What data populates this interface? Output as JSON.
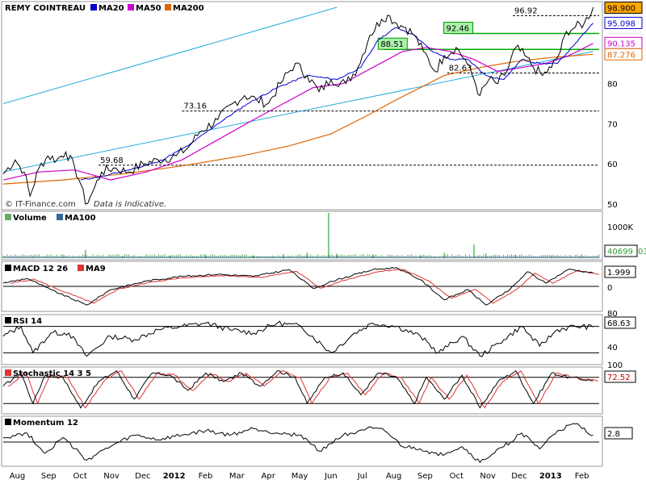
{
  "chart_data": {
    "type": "line",
    "title": "REMY COINTREAU",
    "copyright": "© IT-Finance.com",
    "disclaimer": "Data is Indicative.",
    "x_labels": [
      "Aug",
      "Sep",
      "Oct",
      "Nov",
      "Dec",
      "2012",
      "Feb",
      "Mar",
      "Apr",
      "May",
      "Jun",
      "Jul",
      "Aug",
      "Sep",
      "Oct",
      "Nov",
      "Dec",
      "2013",
      "Feb"
    ],
    "price_panel": {
      "ylim": [
        49,
        100
      ],
      "y_ticks": [
        50,
        60,
        70,
        80
      ],
      "legend": [
        {
          "name": "REMY COINTREAU",
          "color": "#000000"
        },
        {
          "name": "MA20",
          "color": "#0000cc"
        },
        {
          "name": "MA50",
          "color": "#cc00cc"
        },
        {
          "name": "MA200",
          "color": "#dd6600"
        }
      ],
      "badges": [
        {
          "label": "98.900",
          "color": "#ffa500",
          "value": 98.9
        },
        {
          "label": "95.098",
          "color": "#0000cc",
          "value": 95.1
        },
        {
          "label": "90.135",
          "color": "#cc00cc",
          "value": 90.1
        },
        {
          "label": "87.276",
          "color": "#dd6600",
          "value": 87.3
        }
      ],
      "level_labels": [
        {
          "label": "96.92",
          "value": 96.92,
          "from": 0.855
        },
        {
          "label": "92.46",
          "value": 92.46,
          "from": 0.75
        },
        {
          "label": "88.51",
          "value": 88.51,
          "from": 0.64
        },
        {
          "label": "82.63",
          "value": 82.63,
          "from": 0.745
        },
        {
          "label": "73.16",
          "value": 73.16,
          "from": 0.3
        },
        {
          "label": "59.68",
          "value": 59.68,
          "from": 0.16
        }
      ],
      "price_path": [
        [
          0,
          57.5
        ],
        [
          0.02,
          61
        ],
        [
          0.035,
          58
        ],
        [
          0.045,
          52
        ],
        [
          0.06,
          59
        ],
        [
          0.075,
          62
        ],
        [
          0.09,
          61
        ],
        [
          0.105,
          63
        ],
        [
          0.12,
          59
        ],
        [
          0.13,
          55
        ],
        [
          0.138,
          50
        ],
        [
          0.15,
          53
        ],
        [
          0.165,
          58
        ],
        [
          0.185,
          59
        ],
        [
          0.21,
          58
        ],
        [
          0.235,
          60
        ],
        [
          0.26,
          61
        ],
        [
          0.29,
          62
        ],
        [
          0.31,
          64
        ],
        [
          0.33,
          68
        ],
        [
          0.36,
          71
        ],
        [
          0.385,
          75
        ],
        [
          0.405,
          77
        ],
        [
          0.425,
          76
        ],
        [
          0.445,
          75
        ],
        [
          0.465,
          80
        ],
        [
          0.49,
          85
        ],
        [
          0.51,
          82
        ],
        [
          0.53,
          78
        ],
        [
          0.55,
          81
        ],
        [
          0.575,
          80
        ],
        [
          0.595,
          84
        ],
        [
          0.615,
          92
        ],
        [
          0.635,
          96
        ],
        [
          0.645,
          97
        ],
        [
          0.66,
          95
        ],
        [
          0.675,
          94
        ],
        [
          0.69,
          92
        ],
        [
          0.705,
          88
        ],
        [
          0.725,
          83
        ],
        [
          0.74,
          87
        ],
        [
          0.76,
          89
        ],
        [
          0.775,
          86
        ],
        [
          0.79,
          81
        ],
        [
          0.8,
          77
        ],
        [
          0.815,
          81
        ],
        [
          0.83,
          80
        ],
        [
          0.845,
          83
        ],
        [
          0.86,
          89
        ],
        [
          0.875,
          87
        ],
        [
          0.89,
          84
        ],
        [
          0.905,
          82
        ],
        [
          0.92,
          84
        ],
        [
          0.935,
          88
        ],
        [
          0.945,
          93
        ],
        [
          0.96,
          94
        ],
        [
          0.975,
          95
        ],
        [
          0.99,
          99
        ]
      ],
      "ma20_path": [
        [
          0.13,
          56
        ],
        [
          0.17,
          57
        ],
        [
          0.21,
          58.5
        ],
        [
          0.26,
          60.5
        ],
        [
          0.31,
          64.5
        ],
        [
          0.36,
          70
        ],
        [
          0.41,
          75
        ],
        [
          0.46,
          79
        ],
        [
          0.51,
          82
        ],
        [
          0.56,
          81
        ],
        [
          0.6,
          84
        ],
        [
          0.63,
          91
        ],
        [
          0.66,
          94
        ],
        [
          0.69,
          92
        ],
        [
          0.72,
          88
        ],
        [
          0.75,
          86
        ],
        [
          0.78,
          86
        ],
        [
          0.81,
          82
        ],
        [
          0.84,
          81
        ],
        [
          0.87,
          86
        ],
        [
          0.9,
          85
        ],
        [
          0.93,
          85
        ],
        [
          0.96,
          90
        ],
        [
          0.99,
          95
        ]
      ],
      "ma50_path": [
        [
          0.0,
          56
        ],
        [
          0.06,
          58
        ],
        [
          0.12,
          58.5
        ],
        [
          0.18,
          56
        ],
        [
          0.24,
          58
        ],
        [
          0.3,
          61
        ],
        [
          0.36,
          66
        ],
        [
          0.42,
          71
        ],
        [
          0.47,
          75
        ],
        [
          0.52,
          79
        ],
        [
          0.57,
          80
        ],
        [
          0.62,
          84
        ],
        [
          0.67,
          88
        ],
        [
          0.71,
          89
        ],
        [
          0.75,
          88
        ],
        [
          0.79,
          86
        ],
        [
          0.83,
          83
        ],
        [
          0.87,
          84
        ],
        [
          0.91,
          85
        ],
        [
          0.95,
          87
        ],
        [
          0.99,
          90
        ]
      ],
      "ma200_path": [
        [
          0.0,
          55
        ],
        [
          0.1,
          56
        ],
        [
          0.2,
          57.5
        ],
        [
          0.3,
          59.5
        ],
        [
          0.4,
          62
        ],
        [
          0.48,
          64.5
        ],
        [
          0.55,
          67.5
        ],
        [
          0.61,
          72
        ],
        [
          0.66,
          76
        ],
        [
          0.7,
          79
        ],
        [
          0.74,
          82
        ],
        [
          0.8,
          84
        ],
        [
          0.86,
          85.5
        ],
        [
          0.92,
          86.5
        ],
        [
          0.99,
          87.3
        ]
      ],
      "trendline_upper": [
        [
          0.0,
          75
        ],
        [
          0.56,
          99
        ]
      ],
      "trendline_lower": [
        [
          0.0,
          58
        ],
        [
          0.99,
          88
        ]
      ]
    },
    "volume_panel": {
      "legend": [
        {
          "name": "Volume",
          "color": "#66aa66"
        },
        {
          "name": "MA100",
          "color": "#336699"
        }
      ],
      "y_ticks_label": "1000K",
      "badge": "40699",
      "badge_suffix": "03",
      "spikes": [
        [
          0.0,
          0.05
        ],
        [
          0.05,
          0.06
        ],
        [
          0.1,
          0.08
        ],
        [
          0.138,
          0.18
        ],
        [
          0.2,
          0.05
        ],
        [
          0.28,
          0.06
        ],
        [
          0.34,
          0.07
        ],
        [
          0.42,
          0.06
        ],
        [
          0.47,
          0.09
        ],
        [
          0.51,
          0.12
        ],
        [
          0.546,
          1.0
        ],
        [
          0.56,
          0.1
        ],
        [
          0.62,
          0.08
        ],
        [
          0.7,
          0.07
        ],
        [
          0.74,
          0.12
        ],
        [
          0.79,
          0.3
        ],
        [
          0.81,
          0.1
        ],
        [
          0.86,
          0.07
        ],
        [
          0.92,
          0.06
        ],
        [
          0.97,
          0.08
        ]
      ]
    },
    "macd_panel": {
      "title": "MACD 12 26",
      "signal": "MA9",
      "badge": "1.999",
      "zero_label": "0",
      "ylim": [
        -3.5,
        3.5
      ],
      "path": [
        [
          0,
          0.5
        ],
        [
          0.04,
          1.2
        ],
        [
          0.08,
          -0.5
        ],
        [
          0.14,
          -2.8
        ],
        [
          0.18,
          -0.5
        ],
        [
          0.24,
          0.8
        ],
        [
          0.3,
          1.5
        ],
        [
          0.36,
          1.8
        ],
        [
          0.42,
          1.5
        ],
        [
          0.48,
          2.5
        ],
        [
          0.52,
          -0.3
        ],
        [
          0.56,
          1.0
        ],
        [
          0.62,
          2.5
        ],
        [
          0.66,
          2.8
        ],
        [
          0.7,
          1.0
        ],
        [
          0.74,
          -2.0
        ],
        [
          0.78,
          -0.5
        ],
        [
          0.81,
          -2.8
        ],
        [
          0.85,
          -0.5
        ],
        [
          0.88,
          2.2
        ],
        [
          0.91,
          0.5
        ],
        [
          0.95,
          2.6
        ],
        [
          0.99,
          2.0
        ]
      ]
    },
    "rsi_panel": {
      "title": "RSI 14",
      "badge": "68.63",
      "ylim": [
        0,
        100
      ],
      "y_ticks": [
        80,
        40
      ],
      "levels": [
        70,
        30
      ],
      "path": [
        [
          0,
          55
        ],
        [
          0.03,
          70
        ],
        [
          0.05,
          30
        ],
        [
          0.08,
          60
        ],
        [
          0.11,
          60
        ],
        [
          0.14,
          25
        ],
        [
          0.18,
          55
        ],
        [
          0.22,
          50
        ],
        [
          0.26,
          65
        ],
        [
          0.3,
          70
        ],
        [
          0.34,
          75
        ],
        [
          0.38,
          65
        ],
        [
          0.42,
          60
        ],
        [
          0.46,
          75
        ],
        [
          0.5,
          70
        ],
        [
          0.55,
          30
        ],
        [
          0.59,
          60
        ],
        [
          0.62,
          75
        ],
        [
          0.66,
          70
        ],
        [
          0.7,
          55
        ],
        [
          0.73,
          30
        ],
        [
          0.77,
          55
        ],
        [
          0.8,
          25
        ],
        [
          0.84,
          50
        ],
        [
          0.87,
          70
        ],
        [
          0.9,
          40
        ],
        [
          0.93,
          65
        ],
        [
          0.96,
          70
        ],
        [
          0.99,
          69
        ]
      ]
    },
    "stoch_panel": {
      "title": "Stochastic 14 3 5",
      "badge": "72.52",
      "ylim": [
        0,
        100
      ],
      "y_tick": "100",
      "levels": [
        80,
        20
      ],
      "path": [
        [
          0,
          60
        ],
        [
          0.03,
          90
        ],
        [
          0.05,
          20
        ],
        [
          0.07,
          85
        ],
        [
          0.1,
          80
        ],
        [
          0.13,
          10
        ],
        [
          0.16,
          70
        ],
        [
          0.19,
          95
        ],
        [
          0.22,
          30
        ],
        [
          0.25,
          90
        ],
        [
          0.28,
          85
        ],
        [
          0.31,
          50
        ],
        [
          0.34,
          90
        ],
        [
          0.37,
          70
        ],
        [
          0.4,
          90
        ],
        [
          0.43,
          60
        ],
        [
          0.46,
          95
        ],
        [
          0.49,
          80
        ],
        [
          0.51,
          20
        ],
        [
          0.54,
          80
        ],
        [
          0.57,
          90
        ],
        [
          0.6,
          40
        ],
        [
          0.63,
          90
        ],
        [
          0.66,
          80
        ],
        [
          0.69,
          20
        ],
        [
          0.71,
          80
        ],
        [
          0.74,
          30
        ],
        [
          0.77,
          85
        ],
        [
          0.8,
          10
        ],
        [
          0.83,
          70
        ],
        [
          0.86,
          95
        ],
        [
          0.89,
          20
        ],
        [
          0.92,
          90
        ],
        [
          0.95,
          80
        ],
        [
          0.99,
          72
        ]
      ]
    },
    "momentum_panel": {
      "title": "Momentum 12",
      "badge": "2.8",
      "ylim": [
        -10,
        10
      ],
      "path": [
        [
          0,
          2
        ],
        [
          0.04,
          4
        ],
        [
          0.07,
          -5
        ],
        [
          0.1,
          2
        ],
        [
          0.14,
          -8
        ],
        [
          0.18,
          -2
        ],
        [
          0.22,
          3
        ],
        [
          0.26,
          1
        ],
        [
          0.3,
          3
        ],
        [
          0.34,
          5
        ],
        [
          0.38,
          3
        ],
        [
          0.42,
          6
        ],
        [
          0.46,
          4
        ],
        [
          0.5,
          3
        ],
        [
          0.53,
          -4
        ],
        [
          0.57,
          3
        ],
        [
          0.61,
          6
        ],
        [
          0.64,
          5
        ],
        [
          0.67,
          -2
        ],
        [
          0.7,
          -3
        ],
        [
          0.73,
          -6
        ],
        [
          0.77,
          -2
        ],
        [
          0.8,
          -9
        ],
        [
          0.84,
          -2
        ],
        [
          0.87,
          4
        ],
        [
          0.9,
          -3
        ],
        [
          0.93,
          5
        ],
        [
          0.96,
          8
        ],
        [
          0.99,
          3
        ]
      ]
    }
  }
}
